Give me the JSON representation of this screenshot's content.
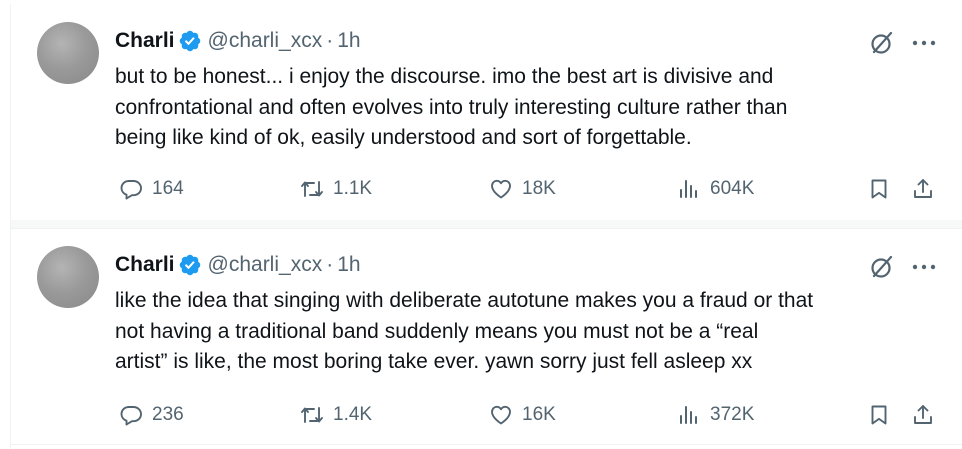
{
  "tweets": [
    {
      "name": "Charli",
      "handle": "@charli_xcx",
      "separator": "·",
      "time": "1h",
      "lines": [
        "but to be honest... i enjoy the discourse.  imo the best art is divisive and",
        "confrontational and often evolves into truly interesting culture rather than",
        "being like kind of ok, easily understood and sort of forgettable."
      ],
      "replies": "164",
      "reposts": "1.1K",
      "likes": "18K",
      "views": "604K"
    },
    {
      "name": "Charli",
      "handle": "@charli_xcx",
      "separator": "·",
      "time": "1h",
      "lines": [
        "like the idea that singing with deliberate autotune makes you a fraud or that",
        "not having a traditional band suddenly means you must not be a “real",
        "artist” is like, the most boring take ever. yawn sorry just fell asleep xx"
      ],
      "replies": "236",
      "reposts": "1.4K",
      "likes": "16K",
      "views": "372K"
    }
  ],
  "colors": {
    "verified": "#1d9bf0",
    "muted": "#536471",
    "text": "#0f1419",
    "border": "#eff3f4"
  },
  "icons": [
    "verified-badge-icon",
    "grok-icon",
    "more-icon",
    "reply-icon",
    "repost-icon",
    "like-icon",
    "views-icon",
    "bookmark-icon",
    "share-icon"
  ]
}
